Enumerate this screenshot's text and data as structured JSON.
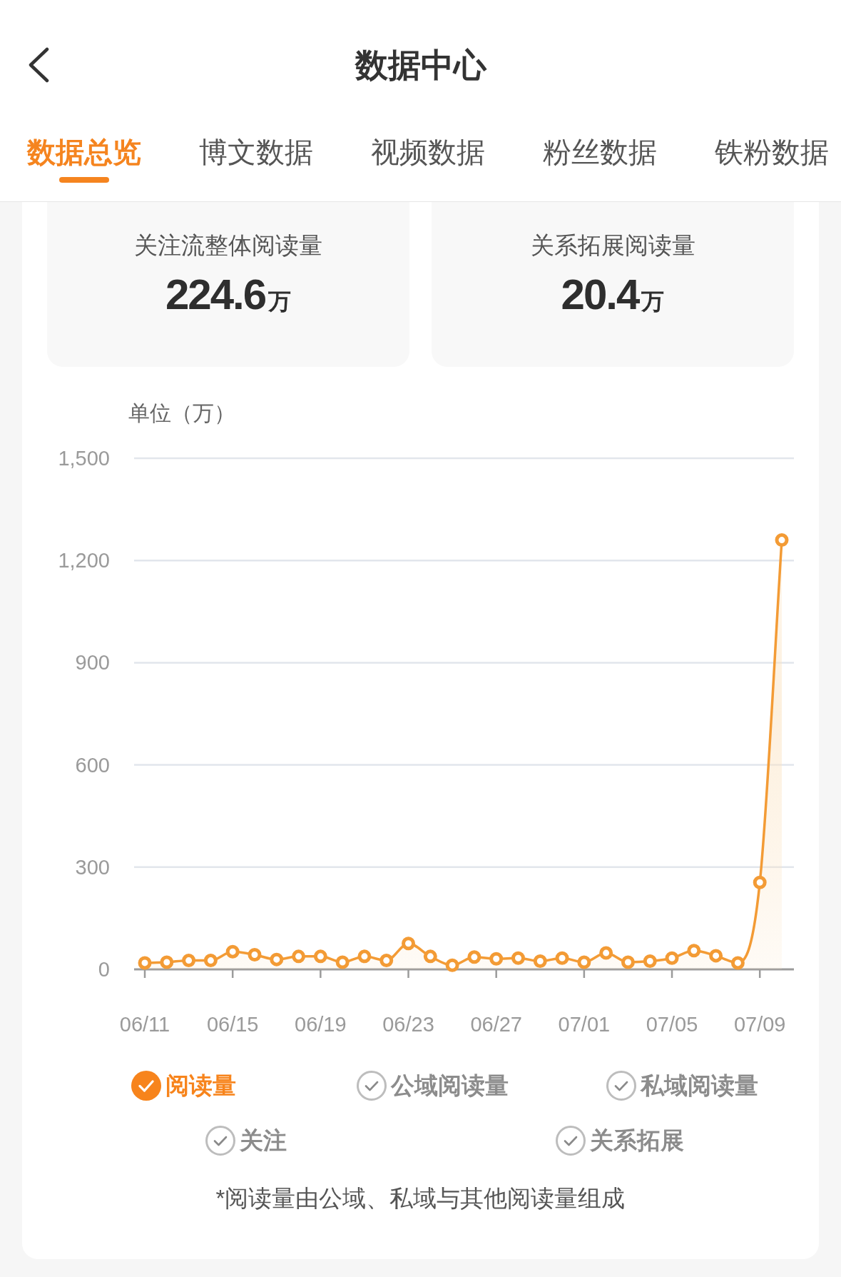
{
  "header": {
    "title": "数据中心"
  },
  "tabs": [
    {
      "label": "数据总览",
      "selected": true
    },
    {
      "label": "博文数据",
      "selected": false
    },
    {
      "label": "视频数据",
      "selected": false
    },
    {
      "label": "粉丝数据",
      "selected": false
    },
    {
      "label": "铁粉数据",
      "selected": false
    }
  ],
  "summary_cards": [
    {
      "label": "关注流整体阅读量",
      "value": "224.6",
      "unit": "万"
    },
    {
      "label": "关系拓展阅读量",
      "value": "20.4",
      "unit": "万"
    }
  ],
  "chart": {
    "chart_data": {
      "type": "area",
      "ylabel": "单位（万）",
      "categories": [
        "06/11",
        null,
        null,
        null,
        "06/15",
        null,
        null,
        null,
        "06/19",
        null,
        null,
        null,
        "06/23",
        null,
        null,
        null,
        "06/27",
        null,
        null,
        null,
        "07/01",
        null,
        null,
        null,
        "07/05",
        null,
        null,
        null,
        "07/09",
        null
      ],
      "ylim": [
        0,
        1500
      ],
      "yticks": [
        {
          "value": 0,
          "label": "0"
        },
        {
          "value": 300,
          "label": "300"
        },
        {
          "value": 600,
          "label": "600"
        },
        {
          "value": 900,
          "label": "900"
        },
        {
          "value": 1200,
          "label": "1,200"
        },
        {
          "value": 1500,
          "label": "1,500"
        }
      ],
      "grid": true,
      "series": [
        {
          "color": "#f39b35",
          "marker": "o",
          "values": [
            19,
            21,
            26,
            26,
            52,
            43,
            29,
            38,
            38,
            21,
            38,
            26,
            76,
            38,
            12,
            36,
            31,
            33,
            24,
            33,
            21,
            48,
            21,
            24,
            33,
            55,
            40,
            19,
            255,
            1260
          ]
        }
      ]
    },
    "legend": [
      {
        "label": "阅读量",
        "checked": true
      },
      {
        "label": "公域阅读量",
        "checked": false
      },
      {
        "label": "私域阅读量",
        "checked": false
      },
      {
        "label": "关注",
        "checked": false
      },
      {
        "label": "关系拓展",
        "checked": false
      }
    ]
  },
  "footnote": "*阅读量由公域、私域与其他阅读量组成"
}
